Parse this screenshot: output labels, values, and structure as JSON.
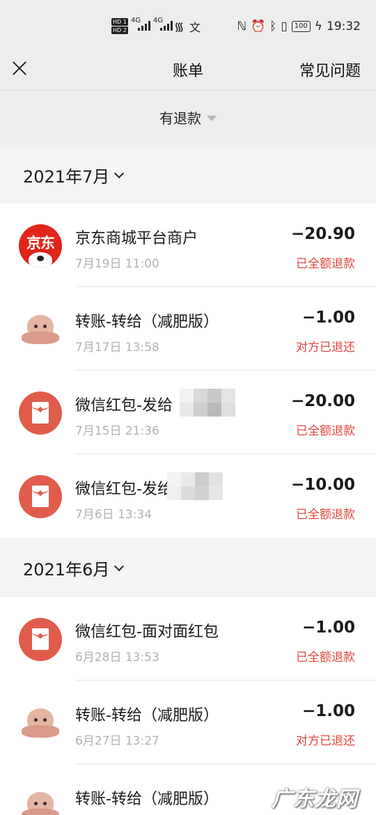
{
  "status_bar": {
    "hd1": "HD 1",
    "hd2": "HD 2",
    "net1": "4G",
    "net2": "4G",
    "battery": "100",
    "time": "19:32"
  },
  "nav": {
    "title": "账单",
    "help_label": "常见问题"
  },
  "filter": {
    "label": "有退款"
  },
  "sections": [
    {
      "month": "2021年7月",
      "rows": [
        {
          "icon": "jd-logo",
          "name": "京东商城平台商户",
          "date": "7月19日 11:00",
          "amount": "−20.90",
          "status": "已全额退款"
        },
        {
          "icon": "octopus-avatar",
          "name": "转账-转给（减肥版）",
          "date": "7月17日 13:58",
          "amount": "−1.00",
          "status": "对方已退还"
        },
        {
          "icon": "red-packet-icon",
          "name": "微信红包-发给",
          "date": "7月15日 21:36",
          "amount": "−20.00",
          "status": "已全额退款"
        },
        {
          "icon": "red-packet-icon",
          "name": "微信红包-发给",
          "date": "7月6日 13:34",
          "amount": "−10.00",
          "status": "已全额退款"
        }
      ]
    },
    {
      "month": "2021年6月",
      "rows": [
        {
          "icon": "red-packet-icon",
          "name": "微信红包-面对面红包",
          "date": "6月28日 13:53",
          "amount": "−1.00",
          "status": "已全额退款"
        },
        {
          "icon": "octopus-avatar",
          "name": "转账-转给（减肥版）",
          "date": "6月27日 13:27",
          "amount": "−1.00",
          "status": "对方已退还"
        },
        {
          "icon": "octopus-avatar",
          "name": "转账-转给（减肥版）",
          "date": "",
          "amount": "",
          "status": ""
        }
      ]
    }
  ],
  "watermark": "广东龙网",
  "colors": {
    "background": "#ededed",
    "refund_red": "#e0463e",
    "red_packet": "#e05d4b",
    "jd_red": "#e1251b"
  }
}
